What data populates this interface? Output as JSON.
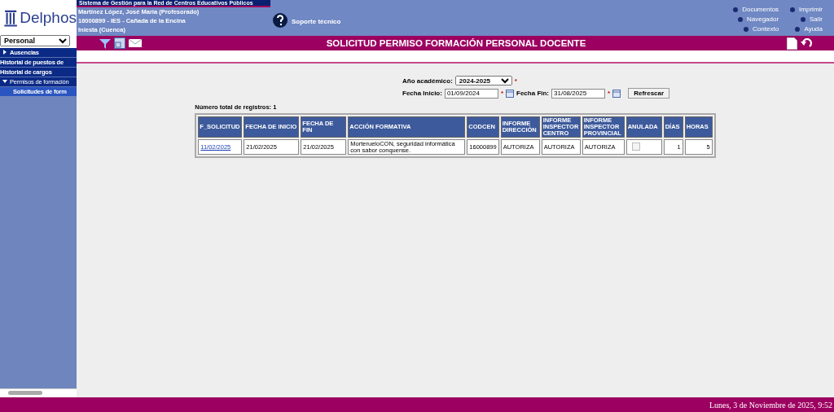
{
  "app": {
    "logo": "Delphos",
    "system_title": "Sistema de Gestión para la Red de Centros Educativos Públicos"
  },
  "user": {
    "lines": [
      "Martínez López, José María (Profesorado)",
      "16000899 - IES - Cañada de la Encina",
      "Iniesta (Cuenca)"
    ],
    "support": "Soporte técnico"
  },
  "top_links": [
    "Documentos",
    "Imprimir",
    "Navegador",
    "Salir",
    "Contexto",
    "Ayuda"
  ],
  "sidebar": {
    "select": "Personal",
    "items": [
      {
        "label": "Ausencias",
        "expanded": false,
        "selected": false
      },
      {
        "label": "Historial de puestos de",
        "selected": false
      },
      {
        "label": "Historial de cargos",
        "selected": false
      },
      {
        "label": "Permisos de formación",
        "expanded": true,
        "selected": false,
        "children": [
          {
            "label": "Solicitudes de form",
            "selected": true
          }
        ]
      }
    ]
  },
  "page_title": "SOLICITUD PERMISO FORMACIÓN PERSONAL DOCENTE",
  "filters": {
    "year_label": "Año académico:",
    "year": "2024-2025",
    "required": "*",
    "start_label": "Fecha Inicio:",
    "start": "01/09/2024",
    "end_label": "Fecha Fin:",
    "end": "31/08/2025",
    "refresh": "Refrescar"
  },
  "total": "Número total de registros: 1",
  "table": {
    "columns": [
      "F_SOLICITUD",
      "FECHA DE INICIO",
      "FECHA DE FIN",
      "ACCIÓN FORMATIVA",
      "CODCEN",
      "INFORME DIRECCIÓN",
      "INFORME INSPECTOR CENTRO",
      "INFORME INSPECTOR PROVINCIAL",
      "ANULADA",
      "DÍAS",
      "HORAS"
    ],
    "rows": [
      {
        "f_solicitud": "11/02/2025",
        "inicio": "21/02/2025",
        "fin": "21/02/2025",
        "accion": "MorterueloCON, seguridad informática con sabor conquense.",
        "codcen": "16000899",
        "direccion": "AUTORIZA",
        "insp_centro": "AUTORIZA",
        "insp_prov": "AUTORIZA",
        "anulada": false,
        "dias": "1",
        "horas": "5"
      }
    ]
  },
  "status_bar": "Lunes, 3 de Noviembre de 2025, 9:52"
}
